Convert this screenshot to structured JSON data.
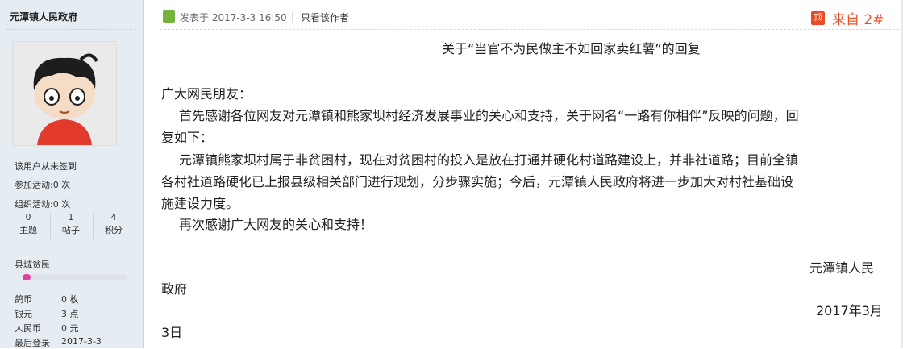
{
  "author": {
    "name": "元潭镇人民政府",
    "signin_status": "该用户从未签到",
    "activities": [
      {
        "label": "参加活动:",
        "value": "0 次"
      },
      {
        "label": "组织活动:",
        "value": "0 次"
      }
    ],
    "stats": [
      {
        "value": "0",
        "label": "主题"
      },
      {
        "value": "1",
        "label": "帖子"
      },
      {
        "value": "4",
        "label": "积分"
      }
    ],
    "rank": "县城贫民",
    "rank_progress": 0.08,
    "wallet": [
      {
        "label": "鸽币",
        "value": "0 枚"
      },
      {
        "label": "银元",
        "value": "3 点"
      },
      {
        "label": "人民币",
        "value": "0 元"
      },
      {
        "label": "最后登录",
        "value": "2017-3-3"
      }
    ]
  },
  "post": {
    "posted_at": "发表于 2017-3-3 16:50",
    "only_author": "只看该作者",
    "top_badge": "顶",
    "floor": "来自 2#",
    "title": "关于“当官不为民做主不如回家卖红薯”的回复",
    "salutation": "广大网民朋友：",
    "lines": [
      "首先感谢各位网友对元潭镇和熊家坝村经济发展事业的关心和支持，关于网名“一路有你相伴”反映的问题，回",
      "复如下：",
      "元潭镇熊家坝村属于非贫困村，现在对贫困村的投入是放在打通并硬化村道路建设上，并非社道路；目前全镇",
      "各村社道路硬化已上报县级相关部门进行规划，分步骤实施；今后，元潭镇人民政府将进一步加大对村社基础设",
      "施建设力度。",
      "再次感谢广大网友的关心和支持！"
    ],
    "signature_line1": "元潭镇人民",
    "signature_line2": "政府",
    "date_line1": "2017年3月",
    "date_line2": "3日"
  },
  "colors": {
    "sidebar_bg": "#e5edf2",
    "floor_color": "#e4572e",
    "rank_bar": "#e040a8"
  }
}
